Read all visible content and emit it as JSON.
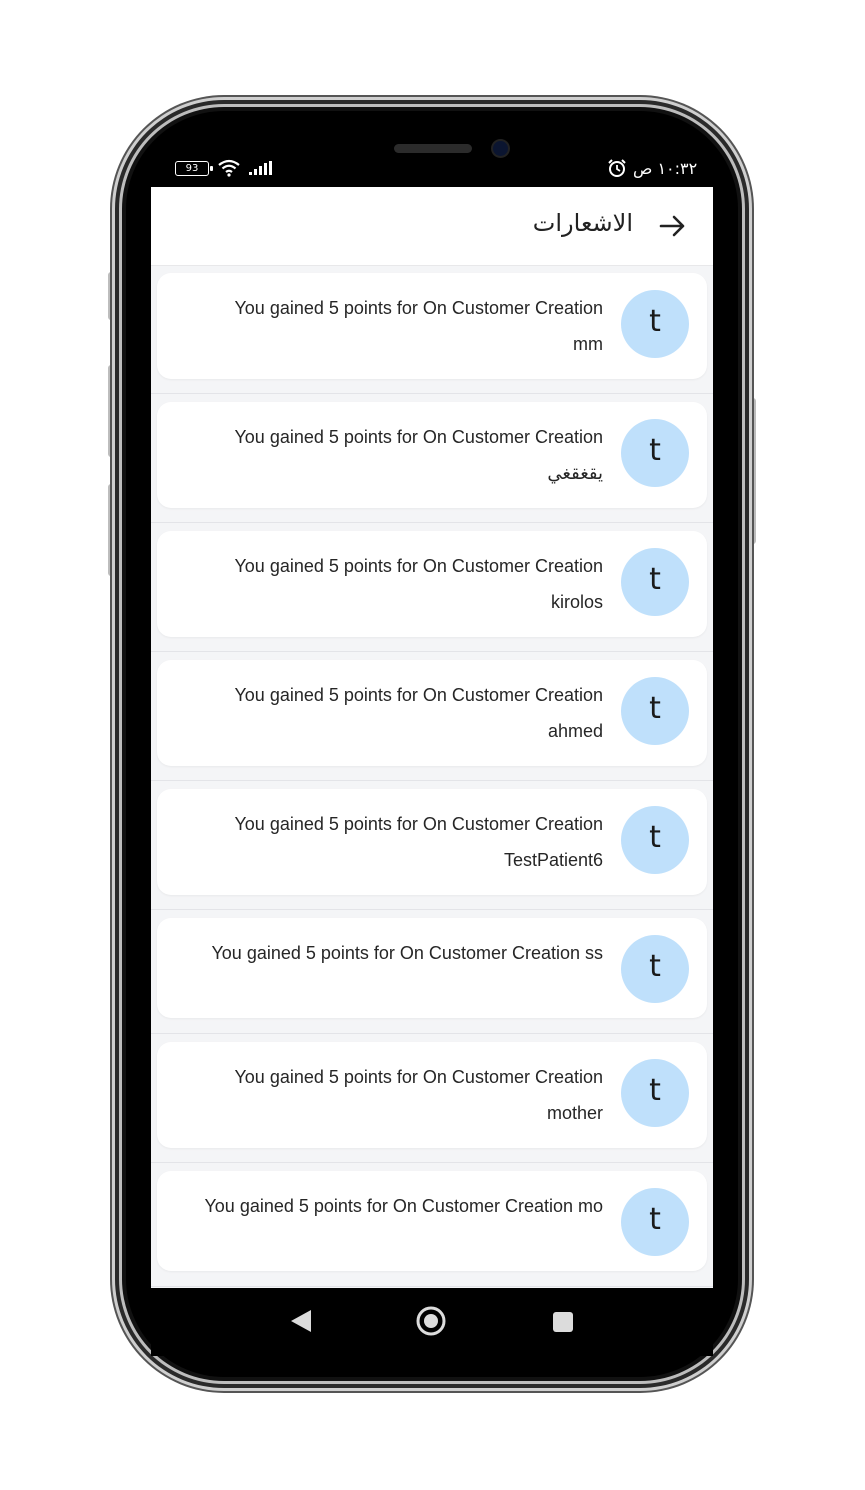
{
  "status_bar": {
    "battery": "93",
    "time": "١٠:٣٢ ص"
  },
  "header": {
    "title": "الاشعارات"
  },
  "notifications": [
    {
      "avatar": "t",
      "line1": "You gained 5 points for On Customer Creation",
      "line2": "mm"
    },
    {
      "avatar": "t",
      "line1": "You gained 5 points for On Customer Creation",
      "line2": "يقغقغي"
    },
    {
      "avatar": "t",
      "line1": "You gained 5 points for On Customer Creation",
      "line2": "kirolos"
    },
    {
      "avatar": "t",
      "line1": "You gained 5 points for On Customer Creation",
      "line2": "ahmed"
    },
    {
      "avatar": "t",
      "line1": "You gained 5 points for On Customer Creation",
      "line2": "TestPatient6"
    },
    {
      "avatar": "t",
      "line1": "You gained 5 points for On Customer Creation ss",
      "line2": ""
    },
    {
      "avatar": "t",
      "line1": "You gained 5 points for On Customer Creation",
      "line2": "mother"
    },
    {
      "avatar": "t",
      "line1": "You gained 5 points for On Customer Creation mo",
      "line2": ""
    }
  ],
  "colors": {
    "avatar_bg": "#bfe0fb",
    "screen_bg": "#f4f5f7",
    "card_bg": "#ffffff"
  }
}
